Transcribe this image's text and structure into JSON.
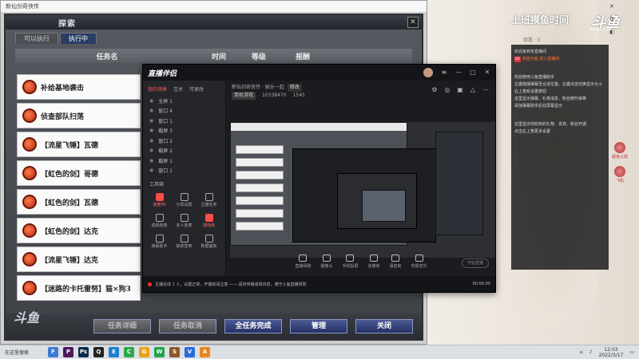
{
  "game": {
    "window_title": "新仙剑奇侠传",
    "title": "探索",
    "tabs": [
      "可以执行",
      "执行中"
    ],
    "columns": [
      "任务名",
      "时间",
      "等级",
      "报酬"
    ],
    "tasks": [
      "补给基地袭击",
      "侦查部队扫荡",
      "【流星飞锤】瓦德",
      "【虹色的剑】哥德",
      "【虹色的剑】瓦德",
      "【虹色的剑】达克",
      "【流星飞锤】达克",
      "【迷路的卡托雷努】猫×狗3"
    ],
    "buttons": [
      "任务详细",
      "任务取消",
      "全任务完成",
      "管理",
      "关闭"
    ],
    "logo": "斗鱼"
  },
  "streamer": {
    "app_name": "直播伴侣",
    "left_tabs": [
      "我的场景",
      "互关",
      "可更改"
    ],
    "scenes": [
      "全屏 1",
      "窗口 4",
      "窗口 1",
      "截屏 3",
      "窗口 2",
      "截屏 2",
      "截屏 1",
      "窗口 1"
    ],
    "tools_label": "工具箱",
    "tools": [
      "连麦PK",
      "分享设置",
      "主播任务",
      "视频连麦",
      "多人连麦",
      "游戏库",
      "弹幕助手",
      "抽奖签到",
      "数据面板",
      "更多"
    ],
    "room_title": "新仙剑奇侠传 · 娱乐一起",
    "room_tag": "修改",
    "room_category": "单机游戏",
    "room_id": "10338470",
    "room_hot": "1545",
    "controls": [
      "直播场景",
      "摄像头",
      "手机投屏",
      "多媒体",
      "语音房",
      "背景音乐"
    ],
    "go_live": "开始直播",
    "status_text": "主播在线 1 人，设置正常，开播前请注意 —— 请勿传播违规内容，遵守斗鱼直播规则",
    "timer": "00:00:00"
  },
  "overlay": {
    "title_text": "上班摸鱼时间",
    "logo": "斗鱼",
    "url": "douyu.com",
    "cam_label": "观看 · 0",
    "chat_lines": [
      "欢迎来到本直播间",
      "欢迎光临 进入直播间",
      "gap",
      "欢迎使用斗鱼直播助手",
      "左键拖拽弹幕至合适位置，右键点击切换显示大小",
      "右上角有设置按钮",
      "这里显示弹幕、礼物消息、粉丝牌升级等",
      "添加弹幕助手后在屏幕显示",
      "gap",
      "这里显示你收到的礼物、贵宾、粉丝开通",
      "点击右上角更多设置"
    ],
    "side_items": [
      "超级火箭",
      "飞机"
    ]
  },
  "taskbar": {
    "search": "在这里搜索",
    "apps": [
      "F",
      "P",
      "Ps",
      "Q",
      "E",
      "C",
      "G",
      "W",
      "S",
      "V",
      "A"
    ],
    "time": "12:03",
    "date": "2022/3/17"
  }
}
